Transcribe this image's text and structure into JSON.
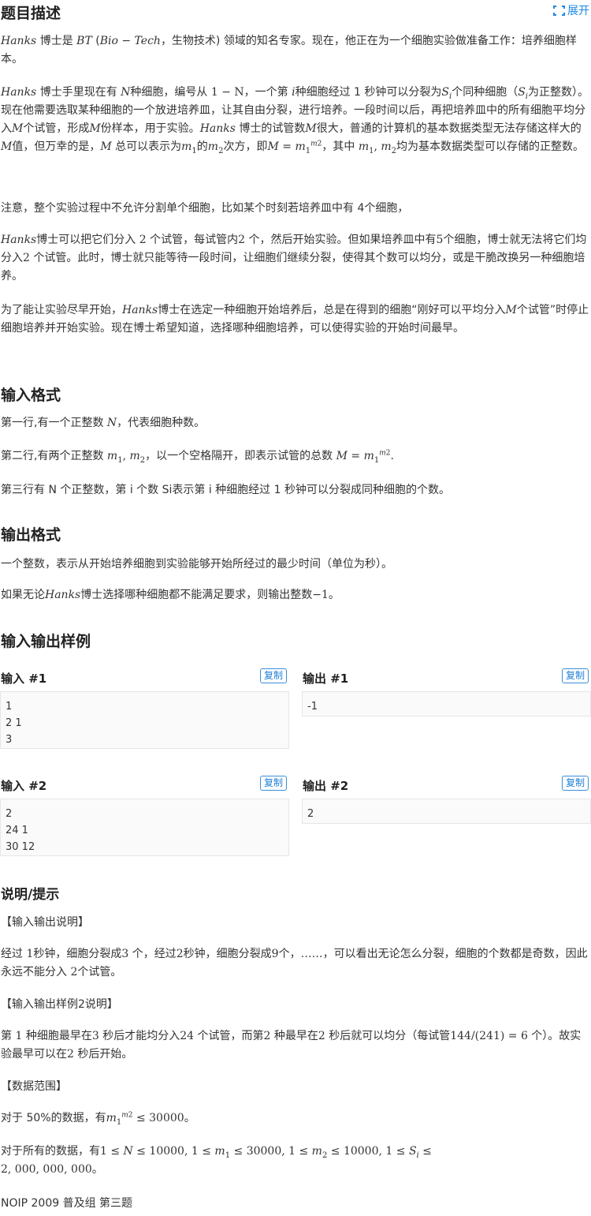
{
  "header": {
    "title": "题目描述",
    "expand_label": "展开"
  },
  "description": {
    "p1": {
      "a": "Hanks",
      "b": " 博士是 ",
      "c": "BT",
      "d": " (",
      "e": "Bio − Tech",
      "f": "，生物技术) 领域的知名专家。现在，他正在为一个细胞实验做准备工作：培养细胞样本。"
    },
    "p2": {
      "a": "Hanks",
      "b": " 博士手里现在有 ",
      "c": "N",
      "d": "种细胞，编号从 ",
      "e": "1 − N",
      "f": "，一个第 ",
      "g": "i",
      "h": "种细胞经过 1 秒钟可以分裂为",
      "i": "S",
      "j": "i",
      "k": "个同种细胞（",
      "l": "S",
      "m": "i",
      "n": "为正整数）。现在他需要选取某种细胞的一个放进培养皿，让其自由分裂，进行培养。一段时间以后，再把培养皿中的所有细胞平均分入",
      "o": "M",
      "p": "个试管，形成",
      "q": "M",
      "r": "份样本，用于实验。",
      "s": "Hanks",
      "t": " 博士的试管数",
      "u": "M",
      "v": "很大，普通的计算机的基本数据类型无法存储这样大的",
      "w": "M",
      "x": "值，但万幸的是，",
      "y": "M",
      "z": " 总可以表示为",
      "m1a": "m",
      "m1b": "1",
      "aa": "的",
      "m2a": "m",
      "m2b": "2",
      "ab": "次方，即",
      "ac": "M",
      "ad": " = ",
      "ae": "m",
      "af": "1",
      "ag": "m",
      "ah": "2",
      "ai": "，其中 ",
      "aj": "m",
      "ak": "1",
      "al": ", ",
      "am": "m",
      "an": "2",
      "ao": "均为基本数据类型可以存储的正整数。"
    },
    "p3": "注意，整个实验过程中不允许分割单个细胞，比如某个时刻若培养皿中有 4个细胞，",
    "p4": {
      "a": "Hanks",
      "b": "博士可以把它们分入 ",
      "c": "2",
      "d": " 个试管，每试管内",
      "e": "2",
      "f": " 个，然后开始实验。但如果培养皿中有",
      "g": "5",
      "h": "个细胞，博士就无法将它们均分入",
      "i": "2",
      "j": " 个试管。此时，博士就只能等待一段时间，让细胞们继续分裂，使得其个数可以均分，或是干脆改换另一种细胞培养。"
    },
    "p5": {
      "a": "为了能让实验尽早开始，",
      "b": "Hanks",
      "c": "博士在选定一种细胞开始培养后，总是在得到的细胞“刚好可以平均分入",
      "d": "M",
      "e": "个试管”时停止细胞培养并开始实验。现在博士希望知道，选择哪种细胞培养，可以使得实验的开始时间最早。"
    }
  },
  "input_format": {
    "title": "输入格式",
    "l1": {
      "a": "第一行,有一个正整数 ",
      "b": "N",
      "c": "，代表细胞种数。"
    },
    "l2": {
      "a": "第二行,有两个正整数 ",
      "b": "m",
      "c": "1",
      "d": ", ",
      "e": "m",
      "f": "2",
      "g": "，以一个空格隔开，即表示试管的总数 ",
      "h": "M",
      "i": " = ",
      "j": "m",
      "k": "1",
      "l": "m",
      "m": "2",
      "n": "."
    },
    "l3": "第三行有 N 个正整数，第 i 个数 Si表示第 i 种细胞经过 1 秒钟可以分裂成同种细胞的个数。"
  },
  "output_format": {
    "title": "输出格式",
    "l1": "一个整数，表示从开始培养细胞到实验能够开始所经过的最少时间（单位为秒）。",
    "l2": {
      "a": "如果无论",
      "b": "Hanks",
      "c": "博士选择哪种细胞都不能满足要求，则输出整数",
      "d": "−1",
      "e": "。"
    }
  },
  "samples": {
    "title": "输入输出样例",
    "copy_label": "复制",
    "in1_label": "输入 #1",
    "out1_label": "输出 #1",
    "in2_label": "输入 #2",
    "out2_label": "输出 #2",
    "in1": [
      "1",
      "2 1",
      "3"
    ],
    "out1": [
      "-1"
    ],
    "in2": [
      "2",
      "24 1",
      "30 12"
    ],
    "out2": [
      "2"
    ]
  },
  "hint": {
    "title": "说明/提示",
    "h1": "【输入输出说明】",
    "p1": {
      "a": "经过 ",
      "b": "1",
      "c": "秒钟，细胞分裂成",
      "d": "3",
      "e": " 个，经过",
      "f": "2",
      "g": "秒钟，细胞分裂成",
      "h": "9",
      "i": "个，……，可以看出无论怎么分裂，细胞的个数都是奇数，因此永远不能分入 ",
      "j": "2",
      "k": "个试管。"
    },
    "h2": "【输入输出样例2说明】",
    "p2": {
      "a": "第 ",
      "b": "1",
      "c": " 种细胞最早在",
      "d": "3",
      "e": " 秒后才能均分入",
      "f": "24",
      "g": " 个试管，而第",
      "h": "2",
      "i": " 种最早在",
      "j": "2",
      "k": " 秒后就可以均分（每试管",
      "l": "144/(241) = 6",
      "m": " 个）。故实验最早可以在",
      "n": "2",
      "o": " 秒后开始。"
    },
    "h3": "【数据范围】",
    "p3": {
      "a": "对于 50%的数据，有",
      "b": "m",
      "c": "1",
      "d": "m",
      "e": "2",
      "f": " ≤ 30000",
      "g": "。"
    },
    "p4": {
      "a": "对于所有的数据，有",
      "b": "1 ≤ ",
      "c": "N",
      "d": " ≤ 10000, 1 ≤ ",
      "e": "m",
      "f": "1",
      "g": " ≤ 30000, 1 ≤ ",
      "h": "m",
      "i": "2",
      "j": " ≤ 10000, 1 ≤ ",
      "k": "S",
      "l": "i",
      "m": " ≤",
      "n": "2, 000, 000, 000",
      "o": "。"
    },
    "footer": "NOIP 2009 普及组 第三题"
  },
  "colors": {
    "accent": "#1e88e5",
    "text": "#333333",
    "heading": "#222222",
    "code_bg": "#fafafa"
  },
  "icons": {
    "expand": "expand-brackets-icon"
  }
}
